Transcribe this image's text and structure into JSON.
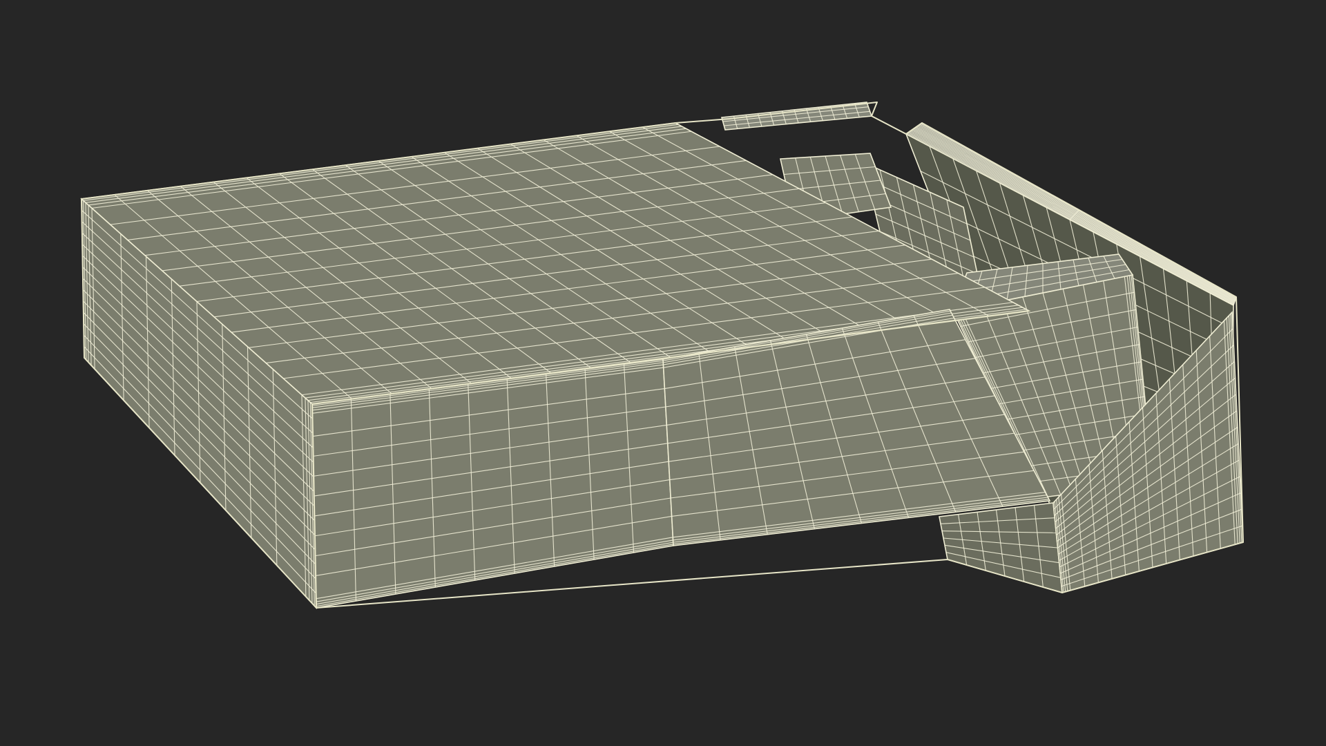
{
  "render": {
    "background_color": "#262626",
    "shaded_fill": "#7b7d6d",
    "shaded_fill_dark": "#6b6d5e",
    "shaded_fill_light": "#85877a",
    "interior_fill": "#55584a",
    "wire_color": "#f2f0d8",
    "edge_color": "#e8e6c8"
  }
}
